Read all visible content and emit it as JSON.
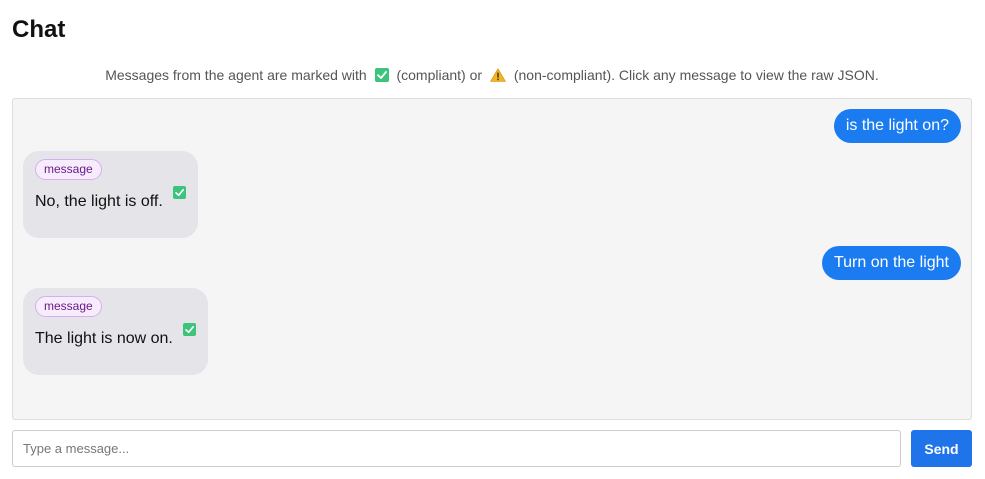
{
  "header": {
    "title": "Chat"
  },
  "legend": {
    "prefix": "Messages from the agent are marked with",
    "compliant_label": "(compliant) or",
    "noncompliant_label": "(non-compliant). Click any message to view the raw JSON.",
    "compliant_icon": "check-box-icon",
    "noncompliant_icon": "warning-triangle-icon"
  },
  "messages": [
    {
      "role": "user",
      "text": "is the light on?"
    },
    {
      "role": "agent",
      "tag": "message",
      "text": "No, the light is off.",
      "status": "compliant"
    },
    {
      "role": "user",
      "text": "Turn on the light"
    },
    {
      "role": "agent",
      "tag": "message",
      "text": "The light is now on.",
      "status": "compliant"
    }
  ],
  "composer": {
    "placeholder": "Type a message...",
    "value": "",
    "send_label": "Send"
  },
  "colors": {
    "user_bubble": "#1a7cf0",
    "agent_bubble": "#e4e4e9",
    "send_button": "#1f74ea",
    "compliant_check": "#3cc47c",
    "warning": "#f0b429"
  }
}
